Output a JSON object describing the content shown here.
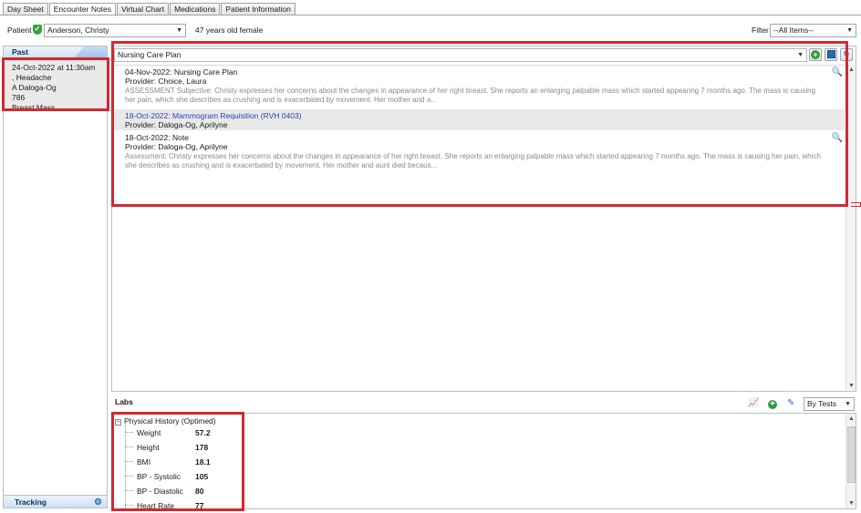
{
  "tabs": [
    {
      "label": "Day Sheet",
      "active": false
    },
    {
      "label": "Encounter Notes",
      "active": true
    },
    {
      "label": "Virtual Chart",
      "active": false
    },
    {
      "label": "Medications",
      "active": false
    },
    {
      "label": "Patient Information",
      "active": false
    }
  ],
  "patient": {
    "label": "Patient",
    "name": "Anderson, Christy",
    "age_gender": "47 years old female"
  },
  "filter": {
    "label": "Filter",
    "value": "--All Items--"
  },
  "sidebar": {
    "past_header": "Past",
    "encounter": {
      "datetime": "24-Oct-2022 at 11:30am",
      "complaint": ", Headache",
      "provider": "A Daloga-Og",
      "code": "786",
      "diagnosis": "Breast Mass"
    },
    "tracking_label": "Tracking"
  },
  "notes": {
    "type_select": "Nursing Care Plan",
    "items": [
      {
        "title": "04-Nov-2022: Nursing Care Plan",
        "provider": "Provider: Choice, Laura",
        "description": "ASSESSMENT    Subjective:  Christy expresses her concerns about the changes in appearance of her right breast. She reports an  enlarging palpable mass which started appearing 7 months ago. The mass is causing her pain, which  she describes as crushing and is exacerbated by movement. Her mother and a..."
      },
      {
        "title": "18-Oct-2022: Mammogram Requisition (RVH 0403)",
        "provider": "Provider: Daloga-Og, Aprilyne",
        "description": ""
      },
      {
        "title": "18-Oct-2022: Note",
        "provider": "Provider: Daloga-Og, Aprilyne",
        "description": "Assessment: Christy expresses her concerns about the changes in appearance of her right breast. She reports an  enlarging palpable mass which started appearing 7 months ago. The mass is causing her pain, which  she describes as crushing and is exacerbated by movement. Her mother and aunt died becaus..."
      }
    ]
  },
  "labs": {
    "title": "Labs",
    "view_select": "By Tests",
    "group": "Physical History (Optimed)",
    "rows": [
      {
        "name": "Weight",
        "value": "57.2"
      },
      {
        "name": "Height",
        "value": "178"
      },
      {
        "name": "BMI",
        "value": "18.1"
      },
      {
        "name": "BP - Systolic",
        "value": "105"
      },
      {
        "name": "BP - Diastolic",
        "value": "80"
      },
      {
        "name": "Heart Rate",
        "value": "77"
      }
    ]
  },
  "colors": {
    "annotation_red": "#d4282f",
    "link_blue": "#2d3fb0",
    "add_green": "#2e9a3b"
  }
}
